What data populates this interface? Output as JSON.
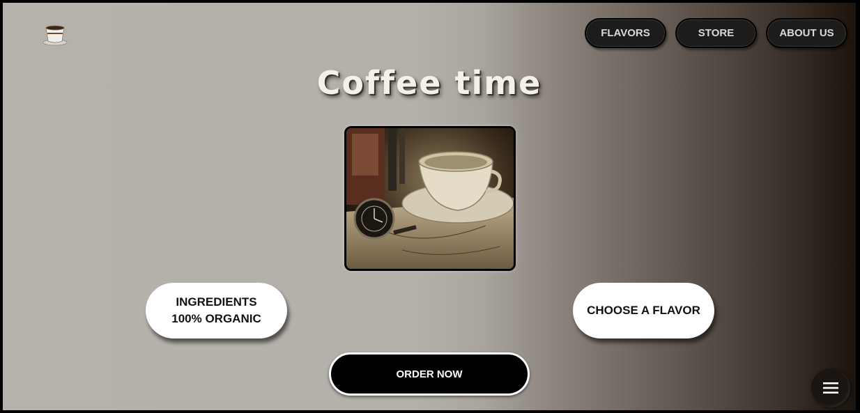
{
  "header": {
    "logo_icon": "coffee-cup-icon",
    "nav": [
      {
        "label": "FLAVORS"
      },
      {
        "label": "STORE"
      },
      {
        "label": "ABOUT US"
      }
    ]
  },
  "hero": {
    "title": "Coffee time",
    "image_icon": "coffee-still-life-image"
  },
  "features": {
    "ingredients_line1": "INGREDIENTS",
    "ingredients_line2": "100% ORGANIC",
    "choose_flavor": "CHOOSE A FLAVOR"
  },
  "cta": {
    "order_label": "ORDER NOW"
  },
  "menu_icon": "hamburger-menu-icon",
  "colors": {
    "nav_bg": "#1e1c1a",
    "cta_bg": "#000000",
    "pill_bg": "#ffffff"
  }
}
